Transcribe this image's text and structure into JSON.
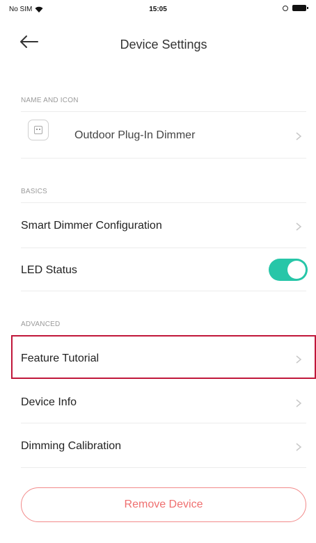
{
  "status_bar": {
    "carrier": "No SIM",
    "time": "15:05"
  },
  "header": {
    "title": "Device Settings"
  },
  "sections": {
    "name_and_icon": "NAME AND ICON",
    "basics": "BASICS",
    "advanced": "ADVANCED"
  },
  "device": {
    "name": "Outdoor Plug-In Dimmer"
  },
  "basics": {
    "smart_dimmer": "Smart Dimmer Configuration",
    "led_status": "LED Status",
    "led_status_on": true
  },
  "advanced": {
    "feature_tutorial": "Feature Tutorial",
    "device_info": "Device Info",
    "dimming_calibration": "Dimming Calibration"
  },
  "actions": {
    "remove_device": "Remove Device"
  },
  "colors": {
    "accent": "#27c6a8",
    "danger": "#ef6f6f",
    "highlight": "#c0163a"
  }
}
